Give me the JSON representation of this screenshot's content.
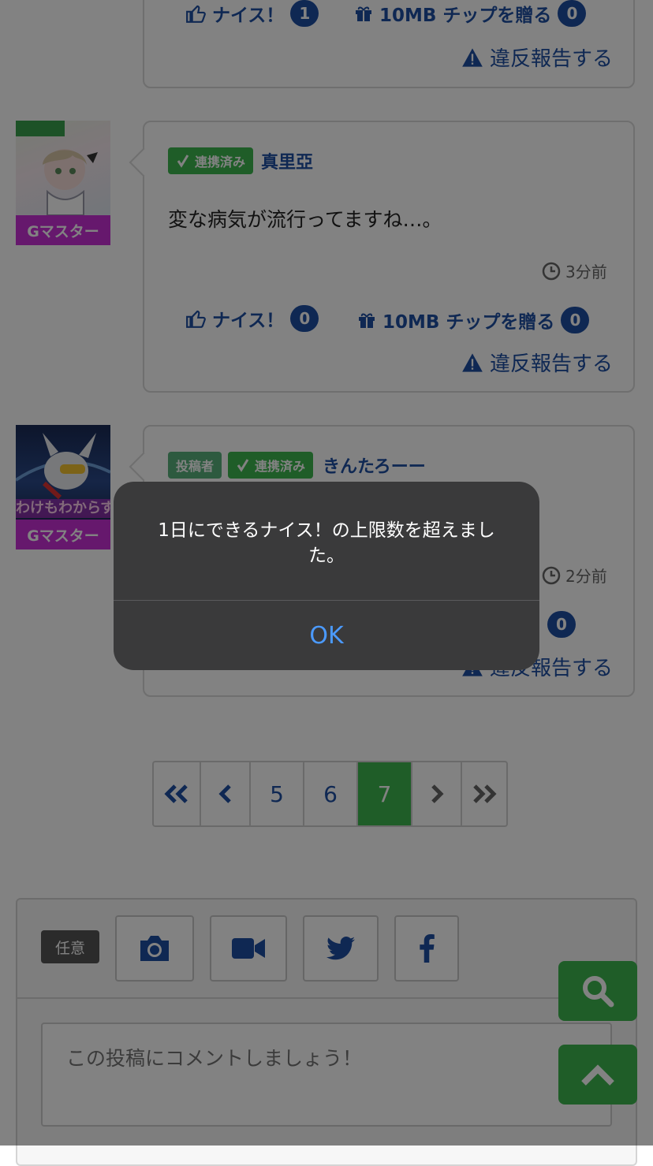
{
  "comments": [
    {
      "nice_label": "ナイス！",
      "nice_count": "1",
      "chip_label": "10MB チップを贈る",
      "chip_count": "0",
      "report_label": "違反報告する"
    },
    {
      "badges": [
        "連携済み"
      ],
      "username": "真里亞",
      "rank": "Gマスター",
      "text": "変な病気が流行ってますね…。",
      "time": "3分前",
      "nice_label": "ナイス！",
      "nice_count": "0",
      "chip_label": "10MB チップを贈る",
      "chip_count": "0",
      "report_label": "違反報告する"
    },
    {
      "poster_badge": "投稿者",
      "badges": [
        "連携済み"
      ],
      "username": "きんたろーー",
      "rank": "Gマスター",
      "avatar_caption": "わけもわからず",
      "time": "2分前",
      "chip_count": "0",
      "report_label": "違反報告する"
    }
  ],
  "pagination": {
    "pages": [
      "5",
      "6",
      "7"
    ],
    "current": "7"
  },
  "composer": {
    "optional_label": "任意",
    "placeholder": "この投稿にコメントしましょう！",
    "icons": [
      "camera-icon",
      "video-icon",
      "twitter-icon",
      "facebook-icon"
    ]
  },
  "alert": {
    "message": "1日にできるナイス！の上限数を超えました。",
    "ok_label": "OK"
  },
  "colors": {
    "accent_blue": "#1f4fa3",
    "green": "#3eb650",
    "rank_purple": "#c82fd6",
    "dialog_bg": "#3a3a3b",
    "ios_blue": "#4b9aff"
  }
}
